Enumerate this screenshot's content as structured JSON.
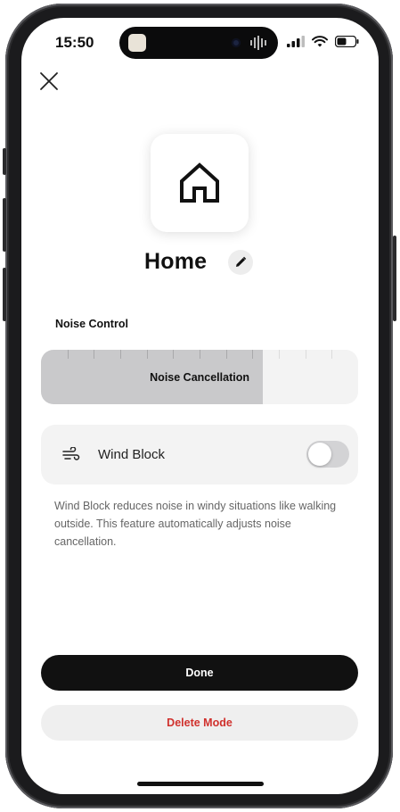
{
  "status_bar": {
    "time": "15:50",
    "icons": [
      "signal-icon",
      "wifi-icon",
      "battery-icon"
    ]
  },
  "header": {
    "close_icon": "close-icon"
  },
  "mode": {
    "icon": "house-icon",
    "title": "Home",
    "edit_icon": "pencil-icon"
  },
  "noise_control": {
    "section_label": "Noise Control",
    "current_setting": "Noise Cancellation",
    "level_fraction": 0.7
  },
  "wind_block": {
    "icon": "wind-icon",
    "label": "Wind Block",
    "enabled": false,
    "description": "Wind Block reduces noise in windy situations like walking outside. This feature automatically adjusts noise cancellation."
  },
  "actions": {
    "done_label": "Done",
    "delete_label": "Delete Mode"
  },
  "colors": {
    "primary": "#111111",
    "danger": "#d0312d",
    "slider_fill": "#c9c9cb"
  }
}
